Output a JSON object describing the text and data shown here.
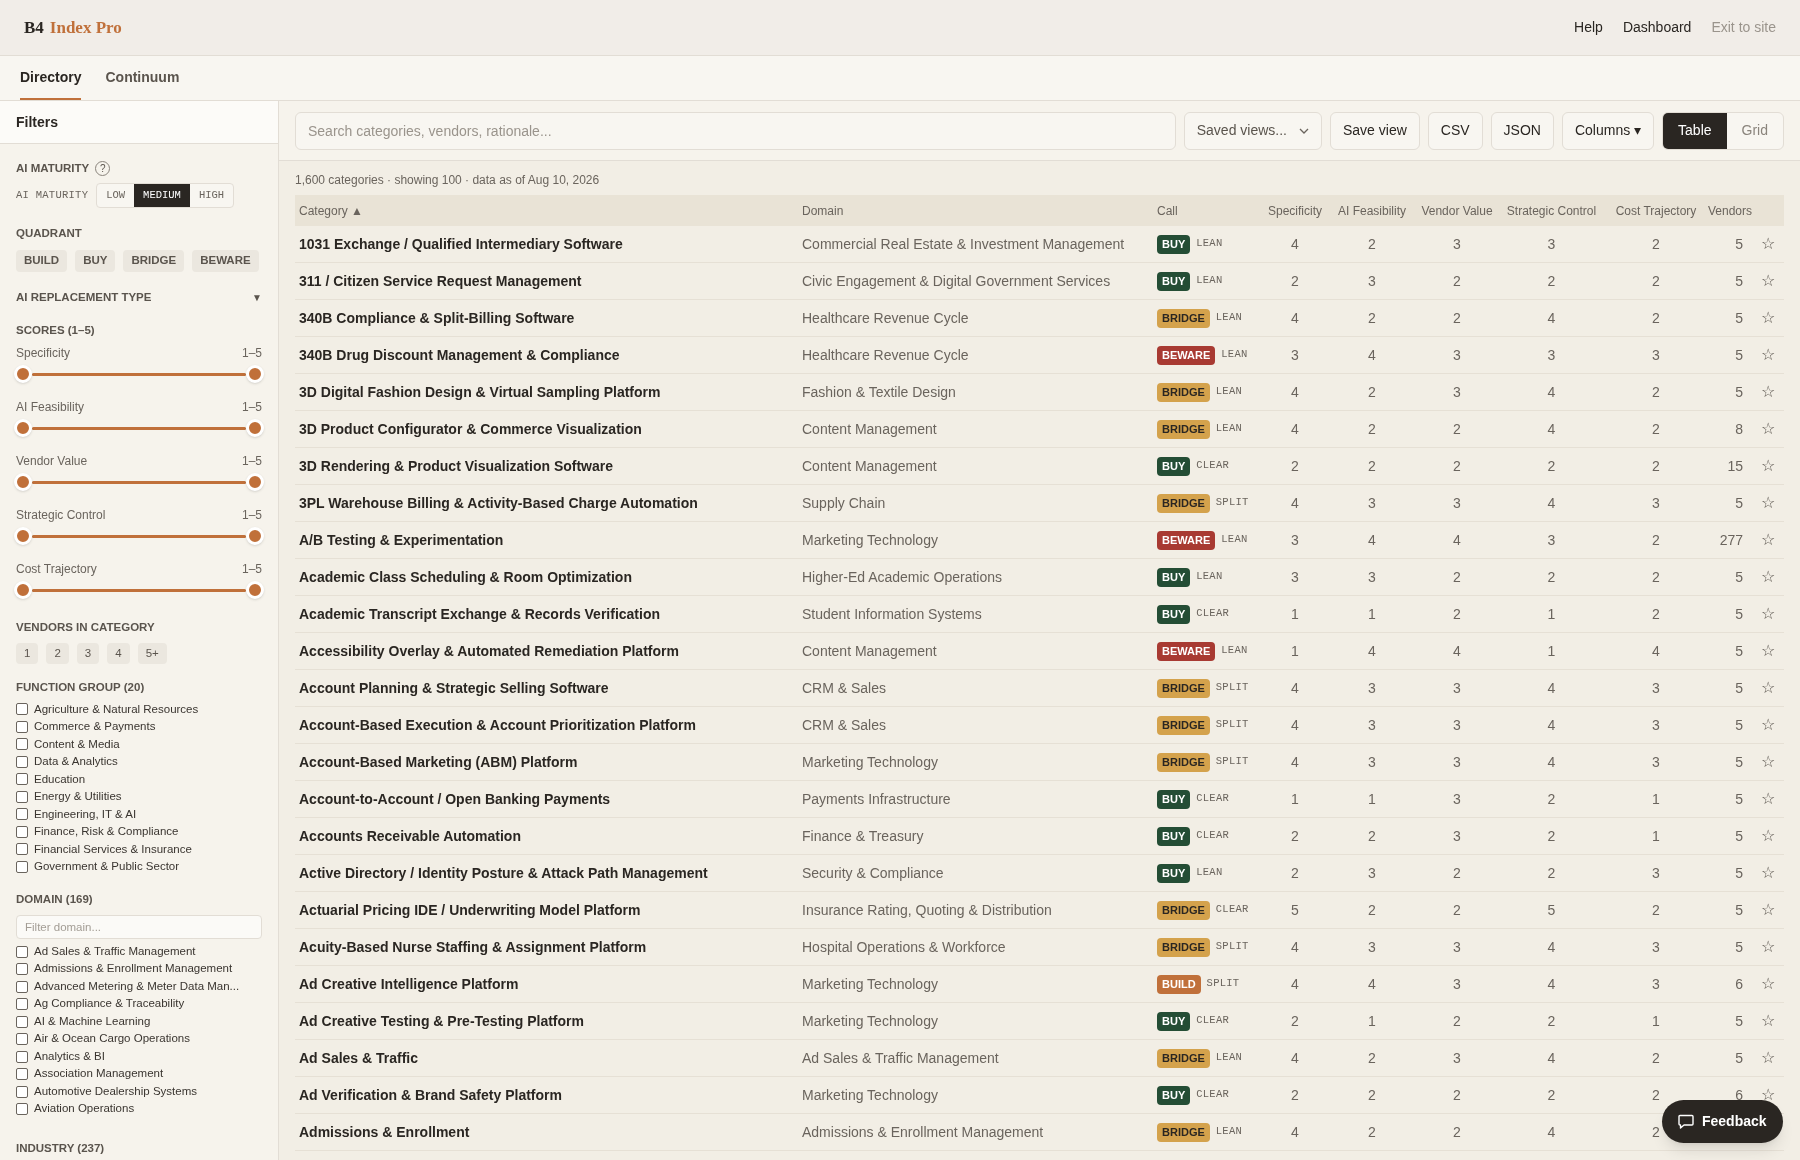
{
  "brand": {
    "mark": "B4",
    "name": "Index Pro"
  },
  "nav": [
    {
      "label": "Help",
      "kind": "strong"
    },
    {
      "label": "Dashboard",
      "kind": "strong"
    },
    {
      "label": "Exit to site",
      "kind": "muted"
    }
  ],
  "tabs": [
    {
      "label": "Directory",
      "selected": true
    },
    {
      "label": "Continuum",
      "selected": false
    }
  ],
  "filters": {
    "title": "Filters",
    "ai_maturity": {
      "heading": "AI MATURITY",
      "help": "?",
      "label": "AI MATURITY",
      "options": [
        {
          "label": "LOW",
          "selected": false
        },
        {
          "label": "MEDIUM",
          "selected": true
        },
        {
          "label": "HIGH",
          "selected": false
        }
      ]
    },
    "quadrant": {
      "heading": "QUADRANT",
      "chips": [
        "BUILD",
        "BUY",
        "BRIDGE",
        "BEWARE"
      ]
    },
    "replacement": {
      "heading": "AI REPLACEMENT TYPE",
      "caret": "▼"
    },
    "scores": {
      "heading": "SCORES (1–5)",
      "sliders": [
        {
          "name": "Specificity",
          "reading": "1–5",
          "level": 1
        },
        {
          "name": "AI Feasibility",
          "reading": "1–5",
          "level": 1
        },
        {
          "name": "Vendor Value",
          "reading": "1–5",
          "level": 1
        },
        {
          "name": "Strategic Control",
          "reading": "1–5",
          "level": 1
        },
        {
          "name": "Cost Trajectory",
          "reading": "1–5",
          "level": 1
        }
      ]
    },
    "vendors": {
      "heading": "VENDORS IN CATEGORY",
      "chips": [
        "1",
        "2",
        "3",
        "4",
        "5+"
      ]
    },
    "function_group": {
      "heading": "FUNCTION GROUP (20)",
      "items": [
        {
          "label": "Agriculture & Natural Resources",
          "checked": false
        },
        {
          "label": "Commerce & Payments",
          "checked": false
        },
        {
          "label": "Content & Media",
          "checked": false
        },
        {
          "label": "Data & Analytics",
          "checked": false
        },
        {
          "label": "Education",
          "checked": false
        },
        {
          "label": "Energy & Utilities",
          "checked": false
        },
        {
          "label": "Engineering, IT & AI",
          "checked": false
        },
        {
          "label": "Finance, Risk & Compliance",
          "checked": false
        },
        {
          "label": "Financial Services & Insurance",
          "checked": false
        },
        {
          "label": "Government & Public Sector",
          "checked": false
        }
      ]
    },
    "domain": {
      "heading": "DOMAIN (169)",
      "placeholder": "Filter domain...",
      "items": [
        {
          "label": "Ad Sales & Traffic Management",
          "checked": false
        },
        {
          "label": "Admissions & Enrollment Management",
          "checked": false
        },
        {
          "label": "Advanced Metering & Meter Data Man...",
          "checked": false
        },
        {
          "label": "Ag Compliance & Traceability",
          "checked": false
        },
        {
          "label": "AI & Machine Learning",
          "checked": false
        },
        {
          "label": "Air & Ocean Cargo Operations",
          "checked": false
        },
        {
          "label": "Analytics & BI",
          "checked": false
        },
        {
          "label": "Association Management",
          "checked": false
        },
        {
          "label": "Automotive Dealership Systems",
          "checked": false
        },
        {
          "label": "Aviation Operations",
          "checked": false
        }
      ]
    },
    "industry": {
      "heading": "INDUSTRY (237)"
    }
  },
  "toolbar": {
    "search_placeholder": "Search categories, vendors, rationale...",
    "saved_views": "Saved views...",
    "buttons": [
      "Save view",
      "CSV",
      "JSON"
    ],
    "columns": "Columns",
    "columns_caret": "▾",
    "views": [
      {
        "label": "Table",
        "selected": true
      },
      {
        "label": "Grid",
        "selected": false
      }
    ]
  },
  "summary": "1,600 categories · showing 100 · data as of Aug 10, 2026",
  "table": {
    "columns": [
      "Category ▲",
      "Domain",
      "Call",
      "Specificity",
      "AI Feasibility",
      "Vendor Value",
      "Strategic Control",
      "Cost Trajectory",
      "Vendors"
    ],
    "star": "☆",
    "rows": [
      {
        "category": "1031 Exchange / Qualified Intermediary Software",
        "domain": "Commercial Real Estate & Investment Management",
        "call": {
          "label": "BUY",
          "kind": "buy"
        },
        "fit": "LEAN",
        "scores": [
          "4",
          "2",
          "3",
          "3",
          "2"
        ],
        "vendors": "5"
      },
      {
        "category": "311 / Citizen Service Request Management",
        "domain": "Civic Engagement & Digital Government Services",
        "call": {
          "label": "BUY",
          "kind": "buy"
        },
        "fit": "LEAN",
        "scores": [
          "2",
          "3",
          "2",
          "2",
          "2"
        ],
        "vendors": "5"
      },
      {
        "category": "340B Compliance & Split-Billing Software",
        "domain": "Healthcare Revenue Cycle",
        "call": {
          "label": "BRIDGE",
          "kind": "bridge"
        },
        "fit": "LEAN",
        "scores": [
          "4",
          "2",
          "2",
          "4",
          "2"
        ],
        "vendors": "5"
      },
      {
        "category": "340B Drug Discount Management & Compliance",
        "domain": "Healthcare Revenue Cycle",
        "call": {
          "label": "BEWARE",
          "kind": "beware"
        },
        "fit": "LEAN",
        "scores": [
          "3",
          "4",
          "3",
          "3",
          "3"
        ],
        "vendors": "5"
      },
      {
        "category": "3D Digital Fashion Design & Virtual Sampling Platform",
        "domain": "Fashion & Textile Design",
        "call": {
          "label": "BRIDGE",
          "kind": "bridge"
        },
        "fit": "LEAN",
        "scores": [
          "4",
          "2",
          "3",
          "4",
          "2"
        ],
        "vendors": "5"
      },
      {
        "category": "3D Product Configurator & Commerce Visualization",
        "domain": "Content Management",
        "call": {
          "label": "BRIDGE",
          "kind": "bridge"
        },
        "fit": "LEAN",
        "scores": [
          "4",
          "2",
          "2",
          "4",
          "2"
        ],
        "vendors": "8"
      },
      {
        "category": "3D Rendering & Product Visualization Software",
        "domain": "Content Management",
        "call": {
          "label": "BUY",
          "kind": "buy"
        },
        "fit": "CLEAR",
        "scores": [
          "2",
          "2",
          "2",
          "2",
          "2"
        ],
        "vendors": "15"
      },
      {
        "category": "3PL Warehouse Billing & Activity-Based Charge Automation",
        "domain": "Supply Chain",
        "call": {
          "label": "BRIDGE",
          "kind": "bridge"
        },
        "fit": "SPLIT",
        "scores": [
          "4",
          "3",
          "3",
          "4",
          "3"
        ],
        "vendors": "5"
      },
      {
        "category": "A/B Testing & Experimentation",
        "domain": "Marketing Technology",
        "call": {
          "label": "BEWARE",
          "kind": "beware"
        },
        "fit": "LEAN",
        "scores": [
          "3",
          "4",
          "4",
          "3",
          "2"
        ],
        "vendors": "277"
      },
      {
        "category": "Academic Class Scheduling & Room Optimization",
        "domain": "Higher-Ed Academic Operations",
        "call": {
          "label": "BUY",
          "kind": "buy"
        },
        "fit": "LEAN",
        "scores": [
          "3",
          "3",
          "2",
          "2",
          "2"
        ],
        "vendors": "5"
      },
      {
        "category": "Academic Transcript Exchange & Records Verification",
        "domain": "Student Information Systems",
        "call": {
          "label": "BUY",
          "kind": "buy"
        },
        "fit": "CLEAR",
        "scores": [
          "1",
          "1",
          "2",
          "1",
          "2"
        ],
        "vendors": "5"
      },
      {
        "category": "Accessibility Overlay & Automated Remediation Platform",
        "domain": "Content Management",
        "call": {
          "label": "BEWARE",
          "kind": "beware"
        },
        "fit": "LEAN",
        "scores": [
          "1",
          "4",
          "4",
          "1",
          "4"
        ],
        "vendors": "5"
      },
      {
        "category": "Account Planning & Strategic Selling Software",
        "domain": "CRM & Sales",
        "call": {
          "label": "BRIDGE",
          "kind": "bridge"
        },
        "fit": "SPLIT",
        "scores": [
          "4",
          "3",
          "3",
          "4",
          "3"
        ],
        "vendors": "5"
      },
      {
        "category": "Account-Based Execution & Account Prioritization Platform",
        "domain": "CRM & Sales",
        "call": {
          "label": "BRIDGE",
          "kind": "bridge"
        },
        "fit": "SPLIT",
        "scores": [
          "4",
          "3",
          "3",
          "4",
          "3"
        ],
        "vendors": "5"
      },
      {
        "category": "Account-Based Marketing (ABM) Platform",
        "domain": "Marketing Technology",
        "call": {
          "label": "BRIDGE",
          "kind": "bridge"
        },
        "fit": "SPLIT",
        "scores": [
          "4",
          "3",
          "3",
          "4",
          "3"
        ],
        "vendors": "5"
      },
      {
        "category": "Account-to-Account / Open Banking Payments",
        "domain": "Payments Infrastructure",
        "call": {
          "label": "BUY",
          "kind": "buy"
        },
        "fit": "CLEAR",
        "scores": [
          "1",
          "1",
          "3",
          "2",
          "1"
        ],
        "vendors": "5"
      },
      {
        "category": "Accounts Receivable Automation",
        "domain": "Finance & Treasury",
        "call": {
          "label": "BUY",
          "kind": "buy"
        },
        "fit": "CLEAR",
        "scores": [
          "2",
          "2",
          "3",
          "2",
          "1"
        ],
        "vendors": "5"
      },
      {
        "category": "Active Directory / Identity Posture & Attack Path Management",
        "domain": "Security & Compliance",
        "call": {
          "label": "BUY",
          "kind": "buy"
        },
        "fit": "LEAN",
        "scores": [
          "2",
          "3",
          "2",
          "2",
          "3"
        ],
        "vendors": "5"
      },
      {
        "category": "Actuarial Pricing IDE / Underwriting Model Platform",
        "domain": "Insurance Rating, Quoting & Distribution",
        "call": {
          "label": "BRIDGE",
          "kind": "bridge"
        },
        "fit": "CLEAR",
        "scores": [
          "5",
          "2",
          "2",
          "5",
          "2"
        ],
        "vendors": "5"
      },
      {
        "category": "Acuity-Based Nurse Staffing & Assignment Platform",
        "domain": "Hospital Operations & Workforce",
        "call": {
          "label": "BRIDGE",
          "kind": "bridge"
        },
        "fit": "SPLIT",
        "scores": [
          "4",
          "3",
          "3",
          "4",
          "3"
        ],
        "vendors": "5"
      },
      {
        "category": "Ad Creative Intelligence Platform",
        "domain": "Marketing Technology",
        "call": {
          "label": "BUILD",
          "kind": "build"
        },
        "fit": "SPLIT",
        "scores": [
          "4",
          "4",
          "3",
          "4",
          "3"
        ],
        "vendors": "6"
      },
      {
        "category": "Ad Creative Testing & Pre-Testing Platform",
        "domain": "Marketing Technology",
        "call": {
          "label": "BUY",
          "kind": "buy"
        },
        "fit": "CLEAR",
        "scores": [
          "2",
          "1",
          "2",
          "2",
          "1"
        ],
        "vendors": "5"
      },
      {
        "category": "Ad Sales & Traffic",
        "domain": "Ad Sales & Traffic Management",
        "call": {
          "label": "BRIDGE",
          "kind": "bridge"
        },
        "fit": "LEAN",
        "scores": [
          "4",
          "2",
          "3",
          "4",
          "2"
        ],
        "vendors": "5"
      },
      {
        "category": "Ad Verification & Brand Safety Platform",
        "domain": "Marketing Technology",
        "call": {
          "label": "BUY",
          "kind": "buy"
        },
        "fit": "CLEAR",
        "scores": [
          "2",
          "2",
          "2",
          "2",
          "2"
        ],
        "vendors": "6"
      },
      {
        "category": "Admissions & Enrollment",
        "domain": "Admissions & Enrollment Management",
        "call": {
          "label": "BRIDGE",
          "kind": "bridge"
        },
        "fit": "LEAN",
        "scores": [
          "4",
          "2",
          "2",
          "4",
          "2"
        ]
      }
    ]
  },
  "feedback": "Feedback"
}
